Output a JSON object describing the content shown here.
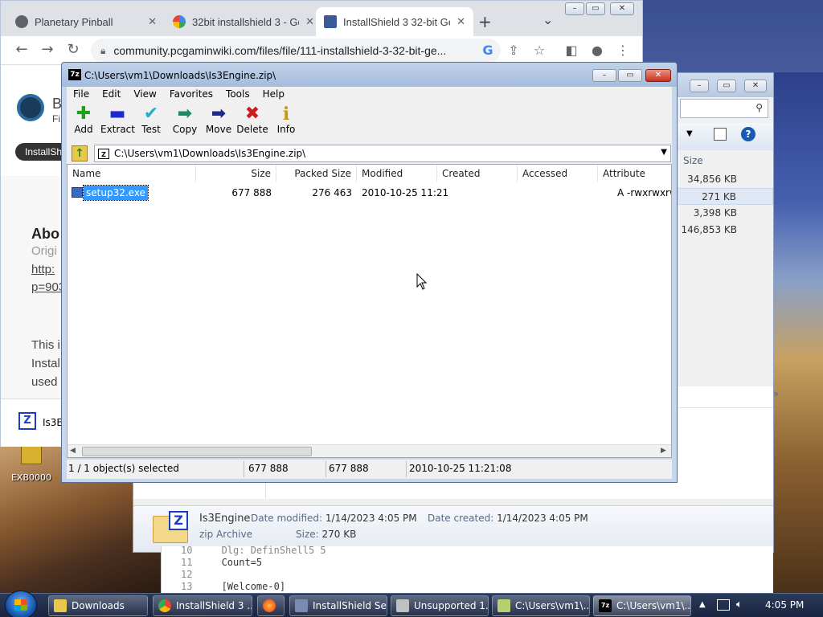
{
  "chrome": {
    "tabs": [
      {
        "title": "Planetary Pinball",
        "active": false
      },
      {
        "title": "32bit installshield 3 - Goo",
        "active": false
      },
      {
        "title": "InstallShield 3 32-bit Ge",
        "active": true
      }
    ],
    "new_tab": "+",
    "tab_search": "⌄",
    "url": "community.pcgaminwiki.com/files/file/111-installshield-3-32-bit-ge...",
    "page": {
      "title_fragment": "B",
      "subtitle_fragment": "Fi",
      "tag_fragment": "InstallSh",
      "heading_fragment": "Abo",
      "lines": [
        "Origi",
        "http:",
        "p=903",
        "This i",
        "Instal",
        "used",
        "use"
      ],
      "download_fragment": "Is3E"
    }
  },
  "explorer": {
    "size_header": "Size",
    "sizes": [
      "34,856 KB",
      "271 KB",
      "3,398 KB",
      "146,853 KB"
    ],
    "selected_size_index": 1,
    "details": {
      "name": "Is3Engine",
      "type": "zip Archive",
      "modified_label": "Date modified:",
      "modified_value": "1/14/2023 4:05 PM",
      "created_label": "Date created:",
      "created_value": "1/14/2023 4:05 PM",
      "size_label": "Size:",
      "size_value": "270 KB"
    }
  },
  "notepad": {
    "lines": [
      {
        "num": "10",
        "text": "Dlg: DefinShell5 5"
      },
      {
        "num": "11",
        "text": "Count=5"
      },
      {
        "num": "12",
        "text": ""
      },
      {
        "num": "13",
        "text": "[Welcome-0]"
      }
    ]
  },
  "desktop": {
    "icon_label": "EXB0000"
  },
  "sevenzip": {
    "title": "C:\\Users\\vm1\\Downloads\\Is3Engine.zip\\",
    "app_icon": "7z",
    "menu": [
      "File",
      "Edit",
      "View",
      "Favorites",
      "Tools",
      "Help"
    ],
    "toolbar": [
      {
        "label": "Add",
        "icon": "plus-icon",
        "glyph": "✚",
        "color": "#1ea01e"
      },
      {
        "label": "Extract",
        "icon": "minus-icon",
        "glyph": "▬",
        "color": "#1a2ad0"
      },
      {
        "label": "Test",
        "icon": "check-icon",
        "glyph": "✔",
        "color": "#20b0c0"
      },
      {
        "label": "Copy",
        "icon": "copy-arrow-icon",
        "glyph": "➡",
        "color": "#1a8a6a"
      },
      {
        "label": "Move",
        "icon": "move-arrow-icon",
        "glyph": "➡",
        "color": "#1a2a8a"
      },
      {
        "label": "Delete",
        "icon": "delete-x-icon",
        "glyph": "✖",
        "color": "#d01a1a"
      },
      {
        "label": "Info",
        "icon": "info-icon",
        "glyph": "i",
        "color": "#c89a10"
      }
    ],
    "address": "C:\\Users\\vm1\\Downloads\\Is3Engine.zip\\",
    "columns": [
      "Name",
      "Size",
      "Packed Size",
      "Modified",
      "Created",
      "Accessed",
      "Attribute"
    ],
    "files": [
      {
        "name": "setup32.exe",
        "size": "677 888",
        "packed": "276 463",
        "modified": "2010-10-25 11:21",
        "created": "",
        "accessed": "",
        "attributes": "A -rwxrwxrw"
      }
    ],
    "status": {
      "selected": "1 / 1 object(s) selected",
      "size": "677 888",
      "packed": "677 888",
      "modified": "2010-10-25 11:21:08"
    }
  },
  "taskbar": {
    "items": [
      {
        "label": "Downloads",
        "active": false
      },
      {
        "label": "InstallShield 3 ...",
        "active": false
      },
      {
        "label": "",
        "active": false
      },
      {
        "label": "InstallShield Se...",
        "active": false
      },
      {
        "label": "Unsupported 1...",
        "active": false
      },
      {
        "label": "C:\\Users\\vm1\\...",
        "active": false
      },
      {
        "label": "C:\\Users\\vm1\\...",
        "active": true
      }
    ],
    "clock": "4:05 PM"
  },
  "colors": {
    "selection": "#3399ff",
    "taskbar": "#1f2c4a",
    "sevenzip_frame": "#b4c8e4"
  }
}
